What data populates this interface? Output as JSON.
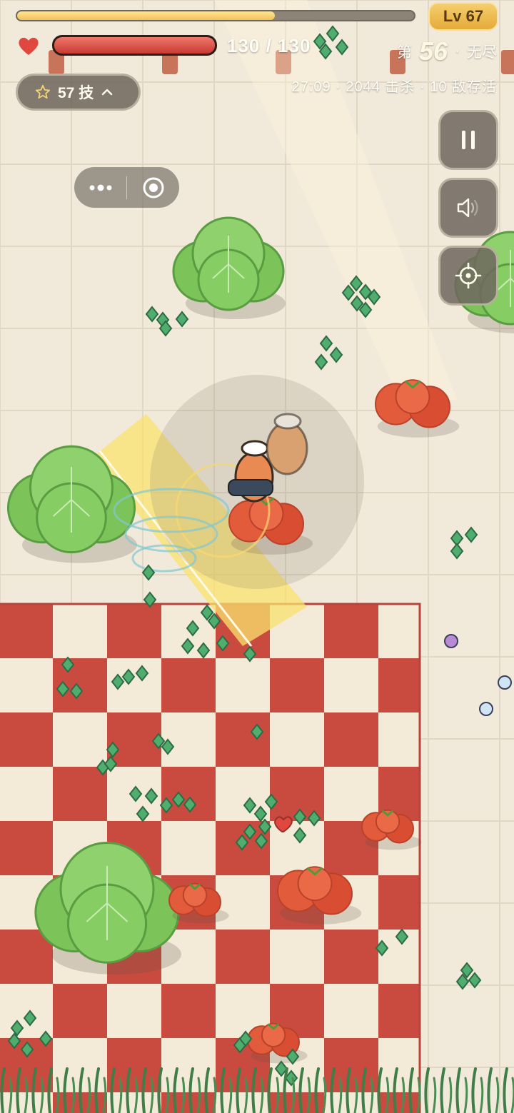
{
  "hud": {
    "xp_progress": 0.65,
    "level_label": "Lv 67",
    "hp_current": 130,
    "hp_max": 130,
    "hp_text": "130 / 130",
    "wave_prefix": "第",
    "wave_number": "56",
    "wave_sep": "·",
    "wave_mode": "无尽",
    "stats_text": "27:09 · 2044 击杀 · 10 敌存活",
    "skills_label": "57 技"
  },
  "icons": {
    "heart": "heart-icon",
    "star": "star-outline-icon",
    "chevron": "chevron-up-icon",
    "menu": "more-dots-icon",
    "close": "target-circle-icon",
    "pause": "pause-icon",
    "sound": "speaker-icon",
    "aim": "crosshair-icon"
  },
  "colors": {
    "xp": "#f3c155",
    "hp": "#d9463c",
    "gem": "#4fae6e",
    "cabbage": "#8fd16d",
    "tomato": "#e25b3a",
    "checker_red": "#c94b3f",
    "checker_cream": "#f4ead8"
  }
}
